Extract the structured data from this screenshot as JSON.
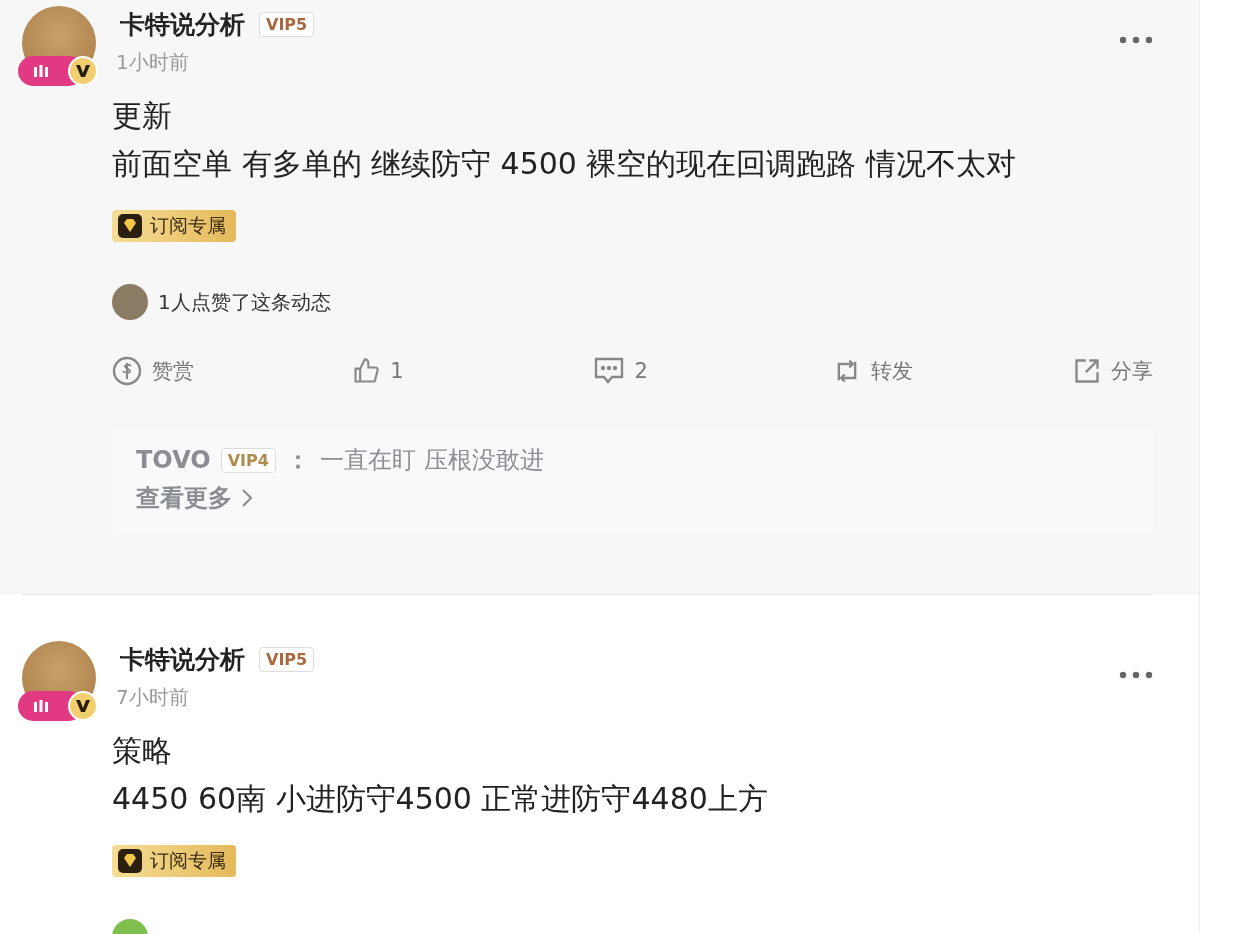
{
  "posts": [
    {
      "highlighted": true,
      "author": "卡特说分析",
      "vip": "VIP5",
      "time": "1小时前",
      "lines": [
        "更新",
        "前面空单 有多单的 继续防守 4500 裸空的现在回调跑路 情况不太对"
      ],
      "tag": "订阅专属",
      "likes": {
        "text": "1人点赞了这条动态"
      },
      "actions": [
        {
          "kind": "reward",
          "label": "赞赏"
        },
        {
          "kind": "like",
          "label": "1"
        },
        {
          "kind": "comment",
          "label": "2"
        },
        {
          "kind": "repost",
          "label": "转发"
        },
        {
          "kind": "share",
          "label": "分享"
        }
      ],
      "comments": [
        {
          "user": "TOVO",
          "vip": "VIP4",
          "sep": "：",
          "text": "一直在盯 压根没敢进"
        }
      ],
      "more": "查看更多"
    },
    {
      "highlighted": false,
      "author": "卡特说分析",
      "vip": "VIP5",
      "time": "7小时前",
      "lines": [
        "策略",
        "4450  60南 小进防守4500  正常进防守4480上方"
      ],
      "tag": "订阅专属",
      "liker_cut": true
    }
  ]
}
